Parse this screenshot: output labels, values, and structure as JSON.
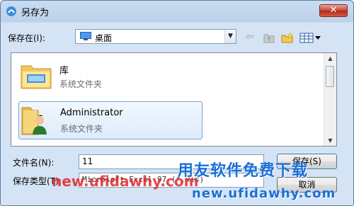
{
  "window": {
    "title": "另存为",
    "close_glyph": "✕"
  },
  "toolbar": {
    "save_in_label": "保存在(I):",
    "save_in_value": "桌面",
    "icons": [
      "back-arrow-icon",
      "up-folder-icon",
      "new-folder-icon",
      "views-menu-icon"
    ]
  },
  "file_list": {
    "items": [
      {
        "name": "库",
        "type": "系统文件夹",
        "icon": "library-folder-icon",
        "selected": false
      },
      {
        "name": "Administrator",
        "type": "系统文件夹",
        "icon": "user-folder-icon",
        "selected": true
      }
    ]
  },
  "form": {
    "filename_label": "文件名(N):",
    "filename_value": "11",
    "filetype_label": "保存类型(T):",
    "filetype_value": "Microsoft Excel 97 (*.xls)",
    "save_button": "保存(S)",
    "cancel_button": "取消"
  },
  "watermark": {
    "brand_text": "用友软件免费下载",
    "url_left": "new.ufidawhy.com",
    "url_right": "new.ufidawhy.com"
  },
  "colors": {
    "accent_blue": "#1b6fd8",
    "watermark_red": "#e3262a",
    "close_red": "#c9453a"
  }
}
